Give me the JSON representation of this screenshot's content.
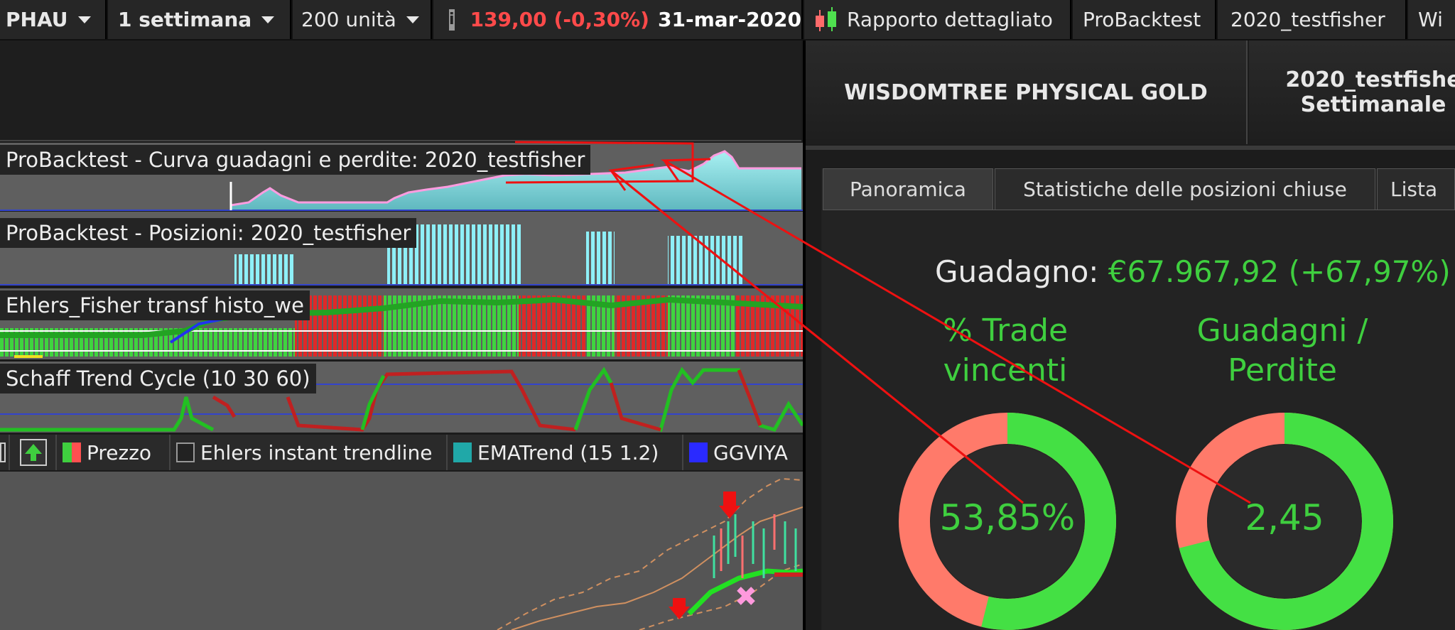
{
  "toolbar": {
    "instrument": "PHAU",
    "timeframe": "1 settimana",
    "units": "200 unità",
    "price": "139,00",
    "change": "(-0,30%)",
    "date": "31-mar-2020",
    "report_label": "Rapporto dettagliato",
    "probacktest_label": "ProBacktest",
    "system_label": "2020_testfisher",
    "truncated_label": "Wi"
  },
  "panels": {
    "equity_label": "ProBacktest - Curva guadagni e perdite: 2020_testfisher",
    "positions_label": "ProBacktest - Posizioni: 2020_testfisher",
    "fisher_label": "Ehlers_Fisher transf histo_we",
    "schaff_label": "Schaff Trend Cycle (10 30 60)"
  },
  "legend": {
    "price": "Prezzo",
    "ehlers": "Ehlers instant trendline",
    "ematrend": "EMATrend (15 1.2)",
    "ggv": "GGVIYA"
  },
  "report": {
    "instrument_name": "WISDOMTREE PHYSICAL GOLD",
    "system_name": "2020_testfishe",
    "period": "Settimanale",
    "tabs": [
      "Panoramica",
      "Statistiche delle posizioni chiuse",
      "Lista"
    ],
    "gain_label": "Guadagno:",
    "gain_value": "€67.967,92 (+67,97%)",
    "win_title_1": "% Trade",
    "win_title_2": "vincenti",
    "ratio_title_1": "Guadagni /",
    "ratio_title_2": "Perdite",
    "win_value": "53,85%",
    "ratio_value": "2,45",
    "win_fraction": 0.5385,
    "ratio_fraction": 0.71
  },
  "colors": {
    "accent_green": "#3fcf3f",
    "loss_red": "#e03030",
    "equity_cyan": "#8ee8ee"
  }
}
